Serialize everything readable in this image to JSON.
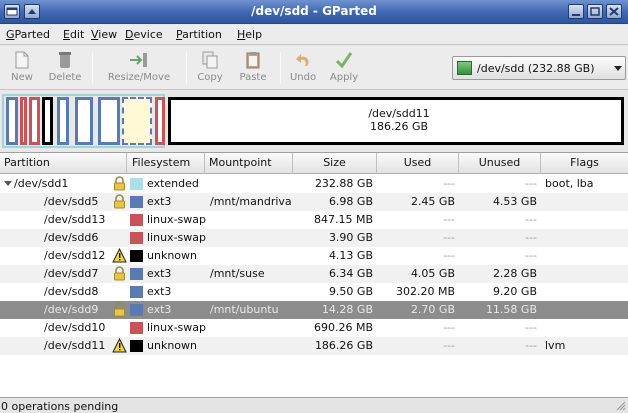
{
  "window": {
    "title": "/dev/sdd - GParted"
  },
  "menu": [
    {
      "label": "GParted",
      "key": "G",
      "rest": "Parted"
    },
    {
      "label": "Edit",
      "key": "E",
      "rest": "dit"
    },
    {
      "label": "View",
      "key": "V",
      "rest": "iew"
    },
    {
      "label": "Device",
      "key": "D",
      "rest": "evice"
    },
    {
      "label": "Partition",
      "key": "P",
      "rest": "artition"
    },
    {
      "label": "Help",
      "key": "H",
      "rest": "elp"
    }
  ],
  "toolbar": {
    "new": "New",
    "delete": "Delete",
    "resize_move": "Resize/Move",
    "copy": "Copy",
    "paste": "Paste",
    "undo": "Undo",
    "apply": "Apply"
  },
  "device_selector": {
    "value": "/dev/sdd    (232.88 GB)"
  },
  "partition_map": {
    "selected_name": "/dev/sdd11",
    "selected_size": "186.26 GB"
  },
  "table": {
    "headers": [
      "Partition",
      "Filesystem",
      "Mountpoint",
      "Size",
      "Used",
      "Unused",
      "Flags"
    ],
    "rows": [
      {
        "partition": "/dev/sdd1",
        "icon": "lock",
        "fs": "extended",
        "fs_color": "#a8dfe8",
        "mount": "",
        "size": "232.88 GB",
        "used": "---",
        "unused": "---",
        "flags": "boot, lba"
      },
      {
        "partition": "/dev/sdd5",
        "icon": "lock",
        "fs": "ext3",
        "fs_color": "#5a7ab6",
        "mount": "/mnt/mandriva",
        "size": "6.98 GB",
        "used": "2.45 GB",
        "unused": "4.53 GB",
        "flags": ""
      },
      {
        "partition": "/dev/sdd13",
        "icon": "",
        "fs": "linux-swap",
        "fs_color": "#c8545a",
        "mount": "",
        "size": "847.15 MB",
        "used": "---",
        "unused": "---",
        "flags": ""
      },
      {
        "partition": "/dev/sdd6",
        "icon": "",
        "fs": "linux-swap",
        "fs_color": "#c8545a",
        "mount": "",
        "size": "3.90 GB",
        "used": "---",
        "unused": "---",
        "flags": ""
      },
      {
        "partition": "/dev/sdd12",
        "icon": "warning",
        "fs": "unknown",
        "fs_color": "#000000",
        "mount": "",
        "size": "4.13 GB",
        "used": "---",
        "unused": "---",
        "flags": ""
      },
      {
        "partition": "/dev/sdd7",
        "icon": "lock",
        "fs": "ext3",
        "fs_color": "#5a7ab6",
        "mount": "/mnt/suse",
        "size": "6.34 GB",
        "used": "4.05 GB",
        "unused": "2.28 GB",
        "flags": ""
      },
      {
        "partition": "/dev/sdd8",
        "icon": "",
        "fs": "ext3",
        "fs_color": "#5a7ab6",
        "mount": "",
        "size": "9.50 GB",
        "used": "302.20 MB",
        "unused": "9.20 GB",
        "flags": ""
      },
      {
        "partition": "/dev/sdd9",
        "icon": "lock",
        "fs": "ext3",
        "fs_color": "#5a7ab6",
        "mount": "/mnt/ubuntu",
        "size": "14.28 GB",
        "used": "2.70 GB",
        "unused": "11.58 GB",
        "flags": "",
        "selected": true
      },
      {
        "partition": "/dev/sdd10",
        "icon": "",
        "fs": "linux-swap",
        "fs_color": "#c8545a",
        "mount": "",
        "size": "690.26 MB",
        "used": "---",
        "unused": "---",
        "flags": ""
      },
      {
        "partition": "/dev/sdd11",
        "icon": "warning",
        "fs": "unknown",
        "fs_color": "#000000",
        "mount": "",
        "size": "186.26 GB",
        "used": "---",
        "unused": "---",
        "flags": "lvm"
      }
    ]
  },
  "status": {
    "text": "0 operations pending"
  }
}
